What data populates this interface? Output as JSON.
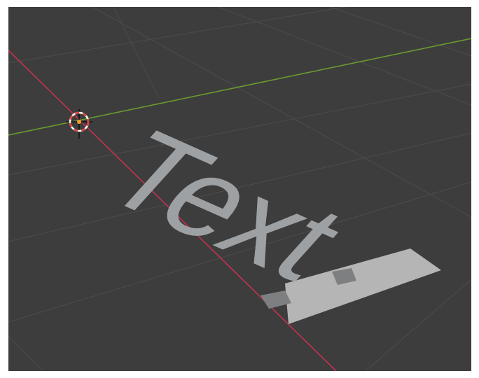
{
  "scene": {
    "text_object": {
      "content": "Text"
    },
    "colors": {
      "viewport_background": "#3d3d3d",
      "grid_line": "#4a4a4a",
      "x_axis": "#c2334f",
      "y_axis": "#6b9a2e",
      "text_face": "#9ea1a4",
      "selection_plane": "#b5b5b5",
      "cursor_ring_red": "#e0403a",
      "cursor_ring_white": "#ffffff",
      "origin_dot": "#f0a030"
    },
    "icons": {
      "cursor": "3d-cursor-icon",
      "origin": "object-origin-icon"
    }
  }
}
